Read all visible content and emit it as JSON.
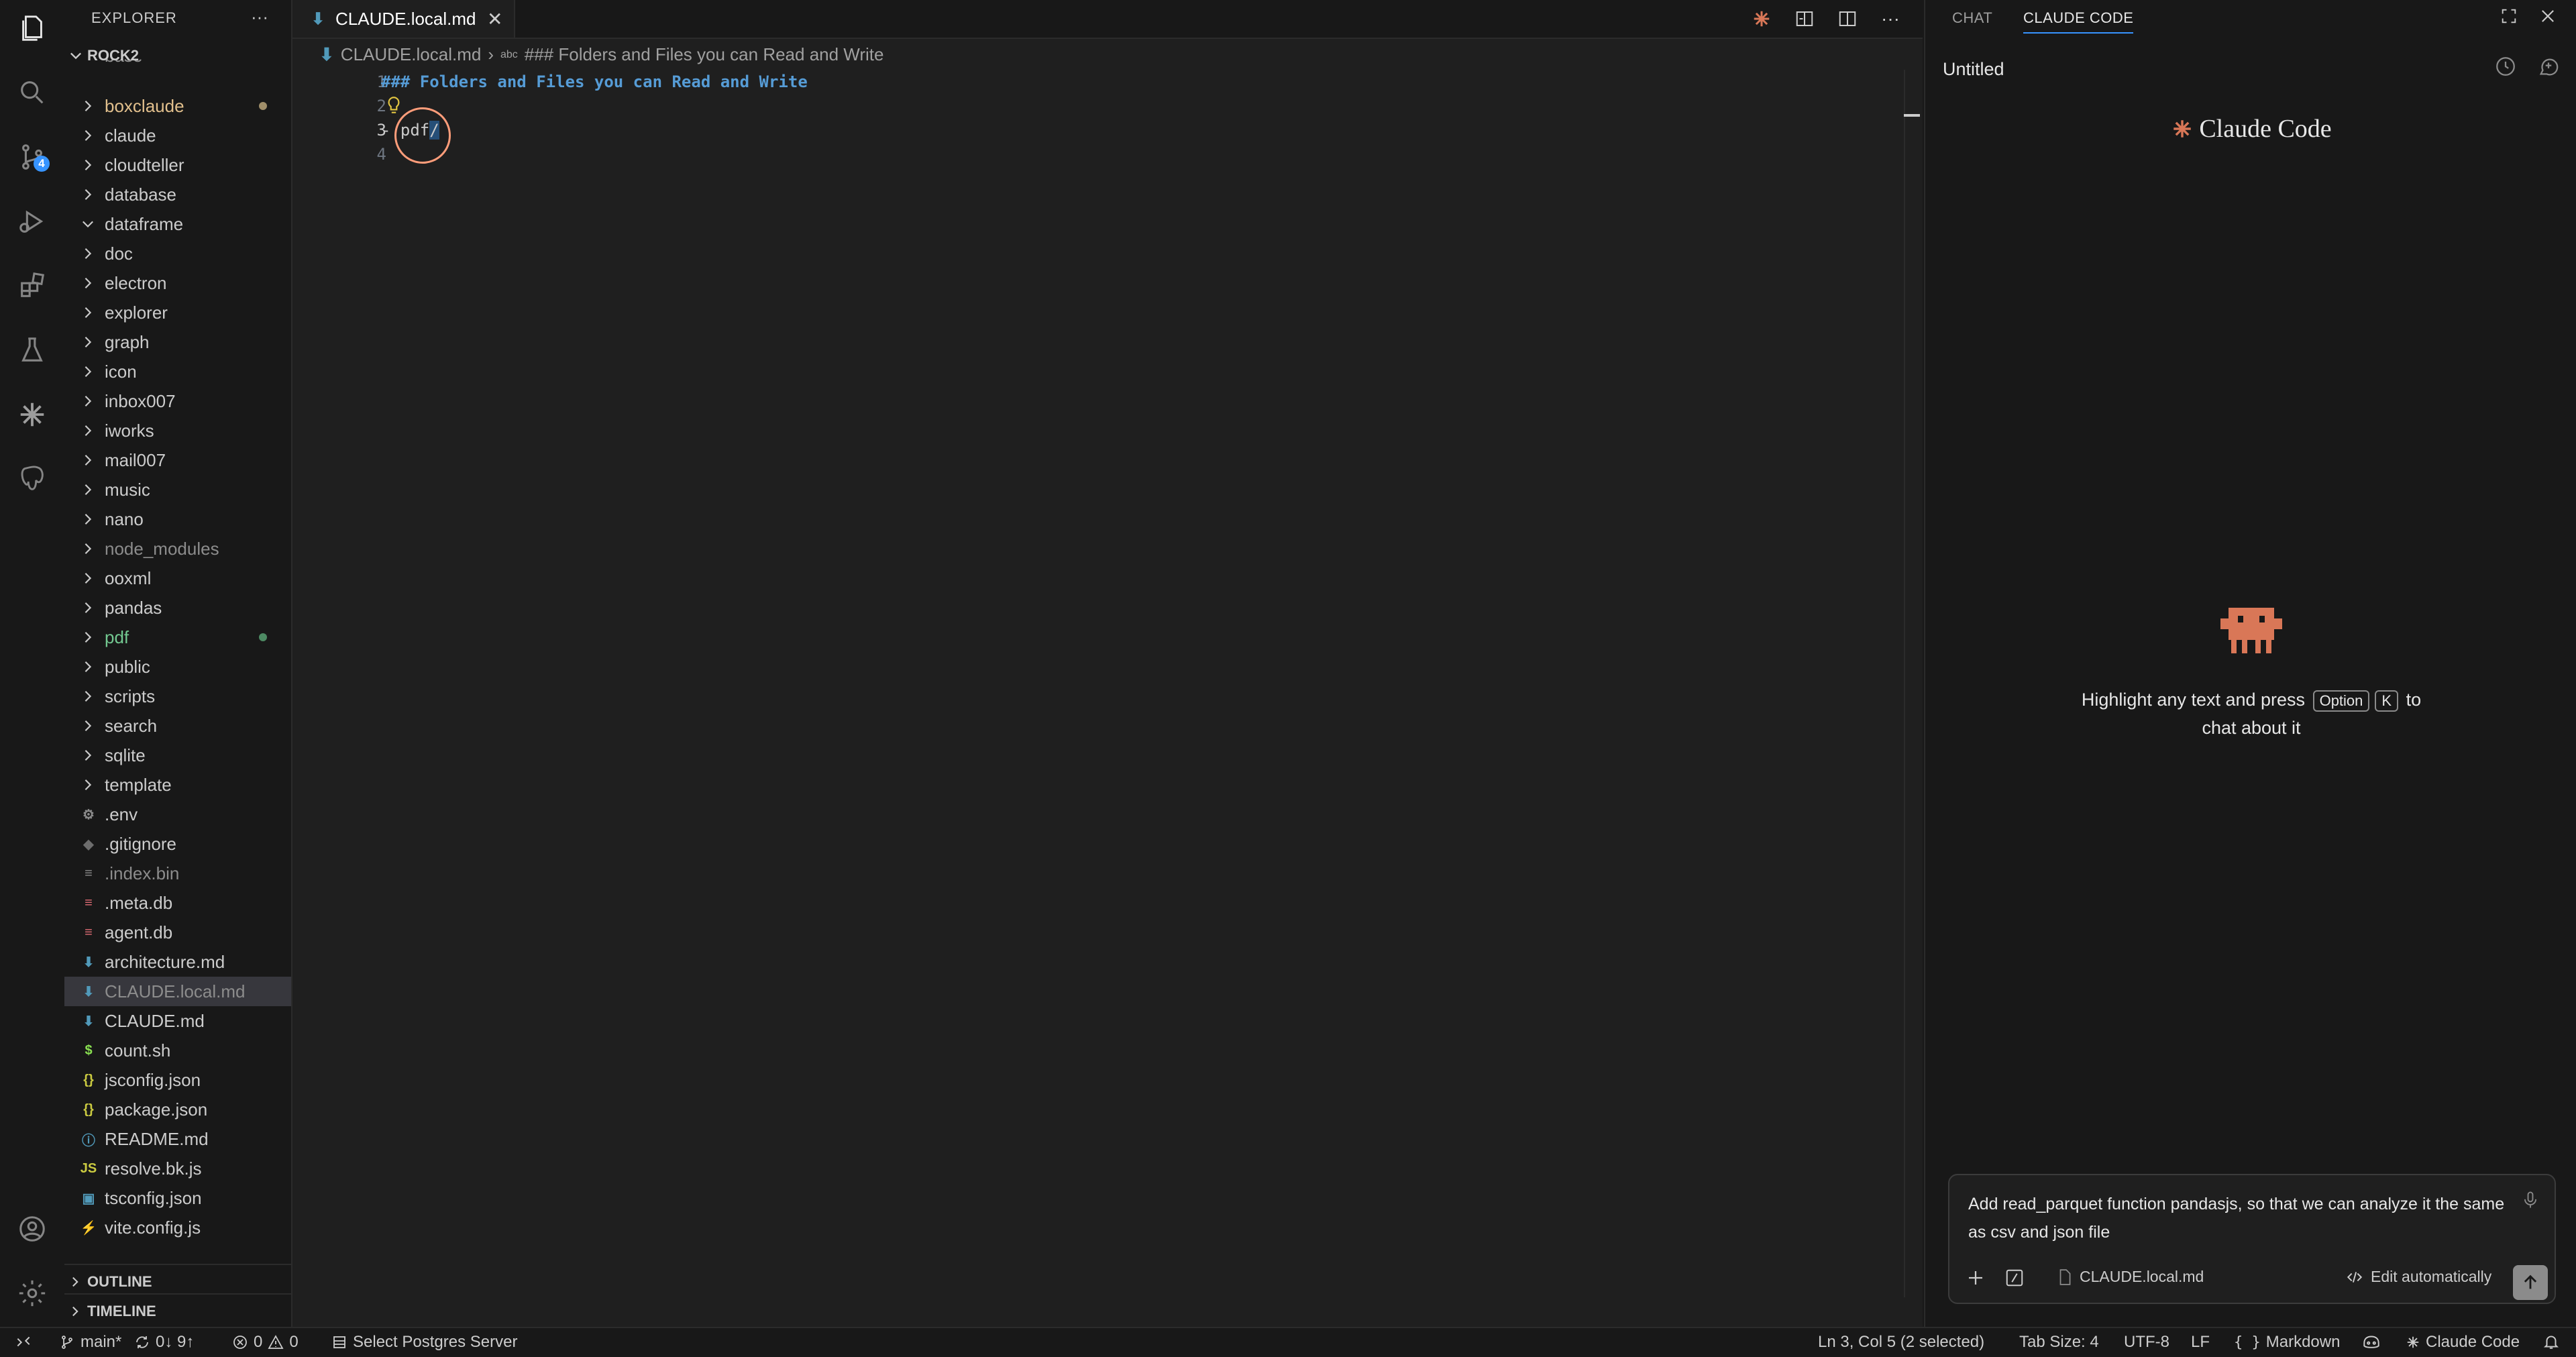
{
  "explorer": {
    "title": "EXPLORER",
    "more": "···",
    "root": "ROCK2",
    "partial_top": "base",
    "folders": [
      {
        "name": "boxclaude",
        "color": "#e2c08d",
        "dot": "#a08f6a"
      },
      {
        "name": "claude",
        "color": "#cccccc",
        "dot": ""
      },
      {
        "name": "cloudteller",
        "color": "#cccccc",
        "dot": ""
      },
      {
        "name": "database",
        "color": "#cccccc",
        "dot": ""
      },
      {
        "name": "dataframe",
        "color": "#cccccc",
        "dot": "",
        "expanded": true
      },
      {
        "name": "doc",
        "color": "#cccccc",
        "dot": ""
      },
      {
        "name": "electron",
        "color": "#cccccc",
        "dot": ""
      },
      {
        "name": "explorer",
        "color": "#cccccc",
        "dot": ""
      },
      {
        "name": "graph",
        "color": "#cccccc",
        "dot": ""
      },
      {
        "name": "icon",
        "color": "#cccccc",
        "dot": ""
      },
      {
        "name": "inbox007",
        "color": "#cccccc",
        "dot": ""
      },
      {
        "name": "iworks",
        "color": "#cccccc",
        "dot": ""
      },
      {
        "name": "mail007",
        "color": "#cccccc",
        "dot": ""
      },
      {
        "name": "music",
        "color": "#cccccc",
        "dot": ""
      },
      {
        "name": "nano",
        "color": "#cccccc",
        "dot": ""
      },
      {
        "name": "node_modules",
        "color": "#8c8c8c",
        "dot": ""
      },
      {
        "name": "ooxml",
        "color": "#cccccc",
        "dot": ""
      },
      {
        "name": "pandas",
        "color": "#cccccc",
        "dot": ""
      },
      {
        "name": "pdf",
        "color": "#73c991",
        "dot": "#4d8a63"
      },
      {
        "name": "public",
        "color": "#cccccc",
        "dot": ""
      },
      {
        "name": "scripts",
        "color": "#cccccc",
        "dot": ""
      },
      {
        "name": "search",
        "color": "#cccccc",
        "dot": ""
      },
      {
        "name": "sqlite",
        "color": "#cccccc",
        "dot": ""
      },
      {
        "name": "template",
        "color": "#cccccc",
        "dot": ""
      }
    ],
    "files": [
      {
        "name": ".env",
        "color": "#cccccc",
        "icon": "⚙",
        "icon_name": "gear-file-icon",
        "icon_color": "#8c8c8c"
      },
      {
        "name": ".gitignore",
        "color": "#cccccc",
        "icon": "◆",
        "icon_name": "git-file-icon",
        "icon_color": "#6d6d6d"
      },
      {
        "name": ".index.bin",
        "color": "#8c8c8c",
        "icon": "≡",
        "icon_name": "binary-file-icon",
        "icon_color": "#8c8c8c"
      },
      {
        "name": ".meta.db",
        "color": "#cccccc",
        "icon": "≡",
        "icon_name": "database-file-icon",
        "icon_color": "#e06c75"
      },
      {
        "name": "agent.db",
        "color": "#cccccc",
        "icon": "≡",
        "icon_name": "database-file-icon",
        "icon_color": "#e06c75"
      },
      {
        "name": "architecture.md",
        "color": "#cccccc",
        "icon": "⬇",
        "icon_name": "markdown-file-icon",
        "icon_color": "#519aba"
      },
      {
        "name": "CLAUDE.local.md",
        "color": "#8c8c8c",
        "icon": "⬇",
        "icon_name": "markdown-file-icon",
        "icon_color": "#519aba",
        "active": true
      },
      {
        "name": "CLAUDE.md",
        "color": "#cccccc",
        "icon": "⬇",
        "icon_name": "markdown-file-icon",
        "icon_color": "#519aba"
      },
      {
        "name": "count.sh",
        "color": "#cccccc",
        "icon": "$",
        "icon_name": "shell-file-icon",
        "icon_color": "#89e051"
      },
      {
        "name": "jsconfig.json",
        "color": "#cccccc",
        "icon": "{}",
        "icon_name": "json-file-icon",
        "icon_color": "#cbcb41"
      },
      {
        "name": "package.json",
        "color": "#cccccc",
        "icon": "{}",
        "icon_name": "json-file-icon",
        "icon_color": "#cbcb41"
      },
      {
        "name": "README.md",
        "color": "#cccccc",
        "icon": "ⓘ",
        "icon_name": "info-file-icon",
        "icon_color": "#519aba"
      },
      {
        "name": "resolve.bk.js",
        "color": "#cccccc",
        "icon": "JS",
        "icon_name": "javascript-file-icon",
        "icon_color": "#cbcb41"
      },
      {
        "name": "tsconfig.json",
        "color": "#cccccc",
        "icon": "▣",
        "icon_name": "typescript-file-icon",
        "icon_color": "#519aba"
      },
      {
        "name": "vite.config.js",
        "color": "#cccccc",
        "icon": "⚡",
        "icon_name": "vite-file-icon",
        "icon_color": "#f6c343"
      }
    ],
    "outline": "OUTLINE",
    "timeline": "TIMELINE"
  },
  "editor": {
    "tab_label": "CLAUDE.local.md",
    "tab_close": "✕",
    "breadcrumb_file": "CLAUDE.local.md",
    "breadcrumb_sep": "›",
    "breadcrumb_abc": "abc",
    "breadcrumb_heading": "### Folders and Files you can Read and Write",
    "line_numbers": [
      "1",
      "2",
      "3",
      "4"
    ],
    "line1": "### Folders and Files you can Read and Write",
    "line3_prefix": "- pdf",
    "line3_selected": "/",
    "toolbar_more": "···"
  },
  "panel": {
    "tab_chat": "CHAT",
    "tab_claude_code": "CLAUDE CODE",
    "title": "Untitled",
    "logo_text": "Claude Code",
    "hint_before": "Highlight any text and press",
    "hint_key1": "Option",
    "hint_key2": "K",
    "hint_to": "to",
    "hint_line2": "chat about it",
    "input_text": "Add read_parquet function pandasjs, so that we can analyze it the same as csv and json file",
    "attach_file": "CLAUDE.local.md",
    "edit_mode": "Edit automatically",
    "accent": "#d97757"
  },
  "statusbar": {
    "branch": "main*",
    "sync": "0↓ 9↑",
    "errors": "0",
    "warnings": "0",
    "postgres": "Select Postgres Server",
    "cursor": "Ln 3, Col 5 (2 selected)",
    "tab_size": "Tab Size: 4",
    "encoding": "UTF-8",
    "eol": "LF",
    "language": "Markdown",
    "claude": "Claude Code"
  },
  "activity": {
    "scm_badge": "4"
  }
}
